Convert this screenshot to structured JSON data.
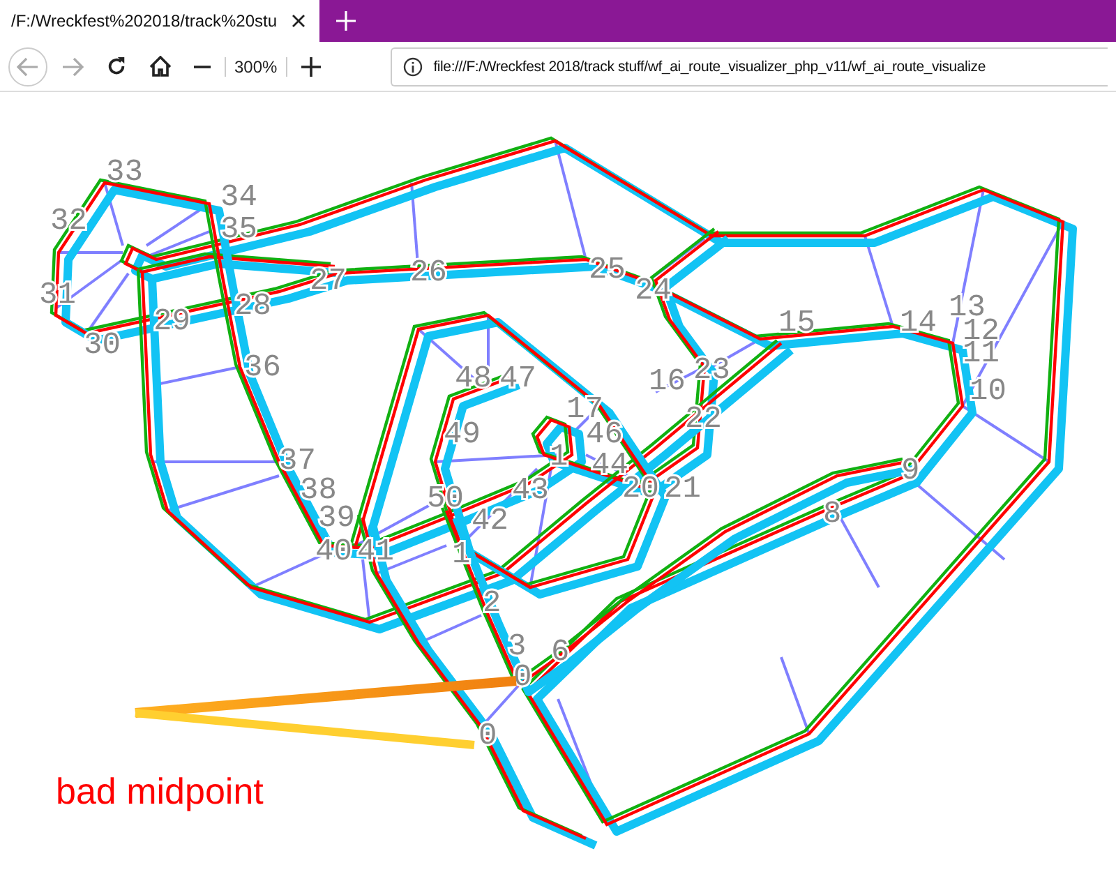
{
  "tabs": [
    {
      "title": "/F:/Wreckfest%202018/track%20stu",
      "selected": true
    }
  ],
  "toolbar": {
    "nav_buttons": [
      {
        "kind": "back",
        "disabled": true
      },
      {
        "kind": "forward",
        "disabled": true
      },
      {
        "kind": "reload",
        "disabled": false
      },
      {
        "kind": "home",
        "disabled": false
      }
    ],
    "zoom_level": "300%",
    "url": "file:///F:/Wreckfest 2018/track stuff/wf_ai_route_visualizer_php_v11/wf_ai_route_visualize"
  },
  "visualizer": {
    "node_labels": [
      "33",
      "32",
      "31",
      "30",
      "29",
      "28",
      "27",
      "26",
      "25",
      "24",
      "34",
      "35",
      "36",
      "37",
      "38",
      "39",
      "40",
      "41",
      "50",
      "42",
      "1",
      "2",
      "3",
      "0",
      "6",
      "48",
      "47",
      "49",
      "17",
      "46",
      "1",
      "44",
      "43",
      "20",
      "21",
      "16",
      "23",
      "22",
      "15",
      "14",
      "13",
      "12",
      "11",
      "10",
      "9",
      "8",
      "0"
    ],
    "annotation": "bad midpoint"
  }
}
